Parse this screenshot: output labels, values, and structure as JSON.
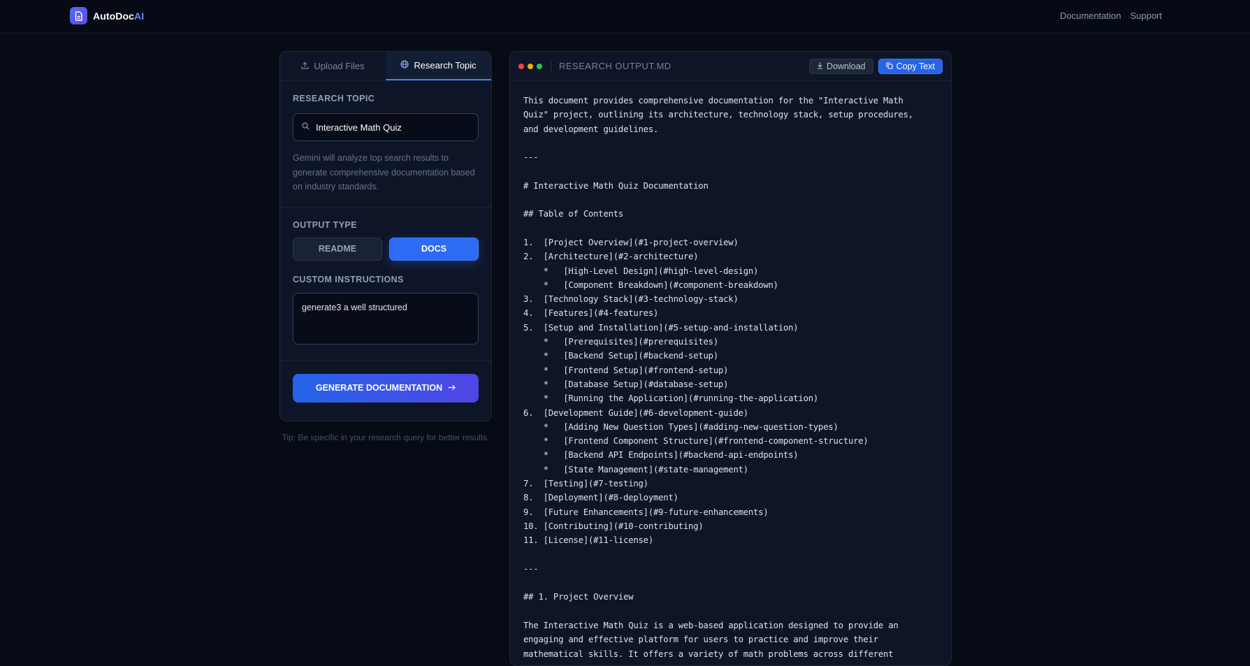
{
  "header": {
    "brand_main": "AutoDoc",
    "brand_accent": "AI",
    "logo_icon": "document-icon",
    "nav": [
      "Documentation",
      "Support"
    ]
  },
  "left_panel": {
    "tabs": [
      {
        "label": "Upload Files",
        "icon": "upload-icon",
        "active": false
      },
      {
        "label": "Research Topic",
        "icon": "globe-icon",
        "active": true
      }
    ],
    "research_topic": {
      "label": "RESEARCH TOPIC",
      "value": "Interactive Math Quiz",
      "help": "Gemini will analyze top search results to generate comprehensive documentation based on industry standards."
    },
    "output_type": {
      "label": "OUTPUT TYPE",
      "options": [
        "README",
        "DOCS"
      ],
      "selected": "DOCS"
    },
    "custom_instructions": {
      "label": "CUSTOM INSTRUCTIONS",
      "value": "generate3 a well structured"
    },
    "generate_label": "GENERATE DOCUMENTATION",
    "tip": "Tip: Be specific in your research query for better results."
  },
  "output_panel": {
    "file_name": "RESEARCH OUTPUT.MD",
    "download_label": "Download",
    "copy_label": "Copy Text",
    "dot_colors": [
      "#ef4444",
      "#eab308",
      "#22c55e"
    ],
    "content": "This document provides comprehensive documentation for the \"Interactive Math\nQuiz\" project, outlining its architecture, technology stack, setup procedures,\nand development guidelines.\n\n---\n\n# Interactive Math Quiz Documentation\n\n## Table of Contents\n\n1.  [Project Overview](#1-project-overview)\n2.  [Architecture](#2-architecture)\n    *   [High-Level Design](#high-level-design)\n    *   [Component Breakdown](#component-breakdown)\n3.  [Technology Stack](#3-technology-stack)\n4.  [Features](#4-features)\n5.  [Setup and Installation](#5-setup-and-installation)\n    *   [Prerequisites](#prerequisites)\n    *   [Backend Setup](#backend-setup)\n    *   [Frontend Setup](#frontend-setup)\n    *   [Database Setup](#database-setup)\n    *   [Running the Application](#running-the-application)\n6.  [Development Guide](#6-development-guide)\n    *   [Adding New Question Types](#adding-new-question-types)\n    *   [Frontend Component Structure](#frontend-component-structure)\n    *   [Backend API Endpoints](#backend-api-endpoints)\n    *   [State Management](#state-management)\n7.  [Testing](#7-testing)\n8.  [Deployment](#8-deployment)\n9.  [Future Enhancements](#9-future-enhancements)\n10. [Contributing](#10-contributing)\n11. [License](#11-license)\n\n---\n\n## 1. Project Overview\n\nThe Interactive Math Quiz is a web-based application designed to provide an\nengaging and effective platform for users to practice and improve their\nmathematical skills. It offers a variety of math problems across different"
  }
}
